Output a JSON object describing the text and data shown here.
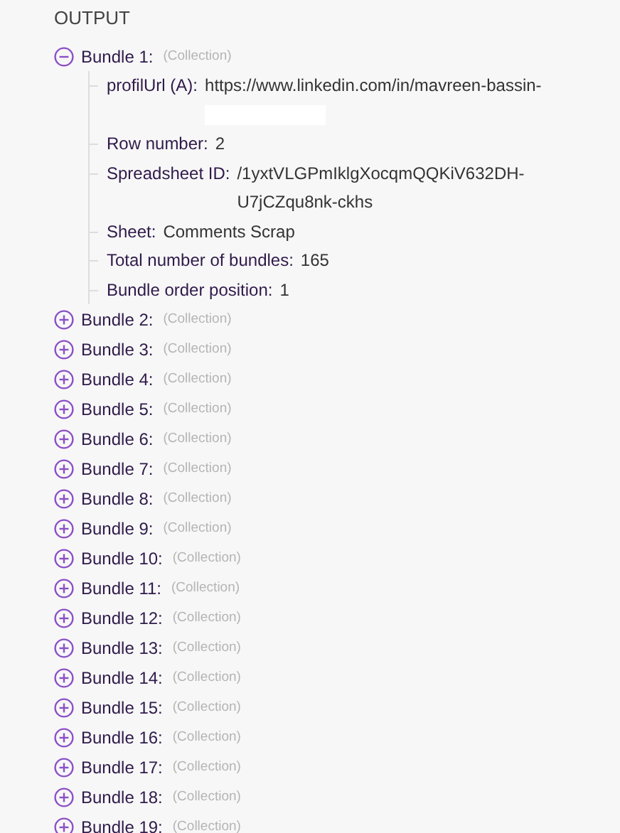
{
  "output": {
    "title": "OUTPUT",
    "bundles": [
      {
        "label": "Bundle 1:",
        "type": "(Collection)",
        "expanded": true,
        "fields": [
          {
            "key": "profilUrl (A):",
            "value": "https://www.linkedin.com/in/mavreen-bassin-",
            "redacted": true
          },
          {
            "key": "Row number:",
            "value": "2",
            "redacted": false
          },
          {
            "key": "Spreadsheet ID:",
            "value": "/1yxtVLGPmIklgXocqmQQKiV632DH-U7jCZqu8nk-ckhs",
            "redacted": false
          },
          {
            "key": "Sheet:",
            "value": "Comments Scrap",
            "redacted": false
          },
          {
            "key": "Total number of bundles:",
            "value": "165",
            "redacted": false
          },
          {
            "key": "Bundle order position:",
            "value": "1",
            "redacted": false
          }
        ]
      },
      {
        "label": "Bundle 2:",
        "type": "(Collection)",
        "expanded": false
      },
      {
        "label": "Bundle 3:",
        "type": "(Collection)",
        "expanded": false
      },
      {
        "label": "Bundle 4:",
        "type": "(Collection)",
        "expanded": false
      },
      {
        "label": "Bundle 5:",
        "type": "(Collection)",
        "expanded": false
      },
      {
        "label": "Bundle 6:",
        "type": "(Collection)",
        "expanded": false
      },
      {
        "label": "Bundle 7:",
        "type": "(Collection)",
        "expanded": false
      },
      {
        "label": "Bundle 8:",
        "type": "(Collection)",
        "expanded": false
      },
      {
        "label": "Bundle 9:",
        "type": "(Collection)",
        "expanded": false
      },
      {
        "label": "Bundle 10:",
        "type": "(Collection)",
        "expanded": false
      },
      {
        "label": "Bundle 11:",
        "type": "(Collection)",
        "expanded": false
      },
      {
        "label": "Bundle 12:",
        "type": "(Collection)",
        "expanded": false
      },
      {
        "label": "Bundle 13:",
        "type": "(Collection)",
        "expanded": false
      },
      {
        "label": "Bundle 14:",
        "type": "(Collection)",
        "expanded": false
      },
      {
        "label": "Bundle 15:",
        "type": "(Collection)",
        "expanded": false
      },
      {
        "label": "Bundle 16:",
        "type": "(Collection)",
        "expanded": false
      },
      {
        "label": "Bundle 17:",
        "type": "(Collection)",
        "expanded": false
      },
      {
        "label": "Bundle 18:",
        "type": "(Collection)",
        "expanded": false
      },
      {
        "label": "Bundle 19:",
        "type": "(Collection)",
        "expanded": false
      }
    ]
  }
}
